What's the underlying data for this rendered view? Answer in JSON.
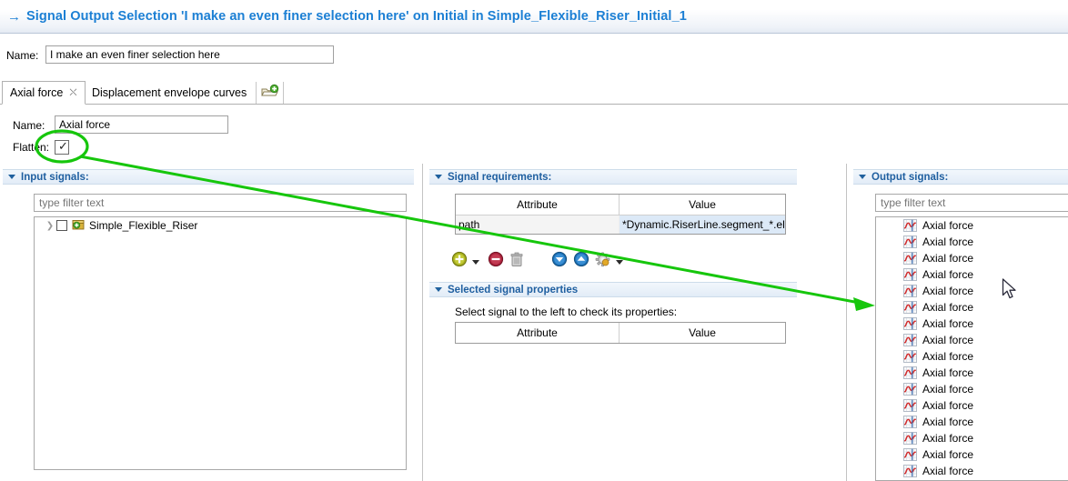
{
  "titlebar": {
    "arrow_icon": "right-arrow-icon",
    "title": "Signal Output Selection 'I make an even finer selection here' on Initial in Simple_Flexible_Riser_Initial_1",
    "accent_color": "#1b7fd4"
  },
  "top_form": {
    "name_label": "Name:",
    "name_value": "I make an even finer selection here"
  },
  "tabs": [
    {
      "label": "Axial force",
      "active": true,
      "close_icon": "close-icon"
    },
    {
      "label": "Displacement envelope curves",
      "active": false
    }
  ],
  "add_tab_button": {
    "icon": "new-tab-icon",
    "tooltip": ""
  },
  "signal_form": {
    "name_label": "Name:",
    "name_value": "Axial force",
    "flatten_label": "Flatten:",
    "flatten_checked": true,
    "check_glyph": "✓"
  },
  "input_signals": {
    "title": "Input signals:",
    "filter_placeholder": "type filter text",
    "tree": [
      {
        "label": "Simple_Flexible_Riser",
        "expand_icon": "chevron-right-icon",
        "checked": false,
        "icon": "project-folder-icon"
      }
    ]
  },
  "signal_requirements": {
    "title": "Signal requirements:",
    "columns": [
      "Attribute",
      "Value"
    ],
    "rows": [
      {
        "attribute": "path",
        "value": "*Dynamic.RiserLine.segment_*.ele"
      }
    ],
    "toolbar": [
      {
        "name": "add-button",
        "icon": "plus-circle-icon"
      },
      {
        "name": "add-dropdown-button",
        "icon": "chevron-down-icon"
      },
      {
        "name": "remove-button",
        "icon": "minus-circle-icon"
      },
      {
        "name": "delete-button",
        "icon": "trash-icon"
      },
      {
        "name": "move-down-button",
        "icon": "arrow-down-circle-icon"
      },
      {
        "name": "move-up-button",
        "icon": "arrow-up-circle-icon"
      },
      {
        "name": "settings-button",
        "icon": "gear-icon"
      },
      {
        "name": "settings-dropdown-button",
        "icon": "chevron-down-icon"
      }
    ]
  },
  "selected_signal_properties": {
    "title": "Selected signal properties",
    "hint": "Select signal to the left to check its properties:",
    "columns": [
      "Attribute",
      "Value"
    ],
    "rows": []
  },
  "output_signals": {
    "title": "Output signals:",
    "filter_placeholder": "type filter text",
    "item_icon": "signal-curve-icon",
    "items": [
      "Axial force",
      "Axial force",
      "Axial force",
      "Axial force",
      "Axial force",
      "Axial force",
      "Axial force",
      "Axial force",
      "Axial force",
      "Axial force",
      "Axial force",
      "Axial force",
      "Axial force",
      "Axial force",
      "Axial force",
      "Axial force"
    ]
  },
  "annotation": {
    "color": "#16c60c",
    "shape": "ellipse-with-arrow",
    "target": "flatten-checkbox"
  },
  "cursor": {
    "icon": "arrow-cursor"
  }
}
